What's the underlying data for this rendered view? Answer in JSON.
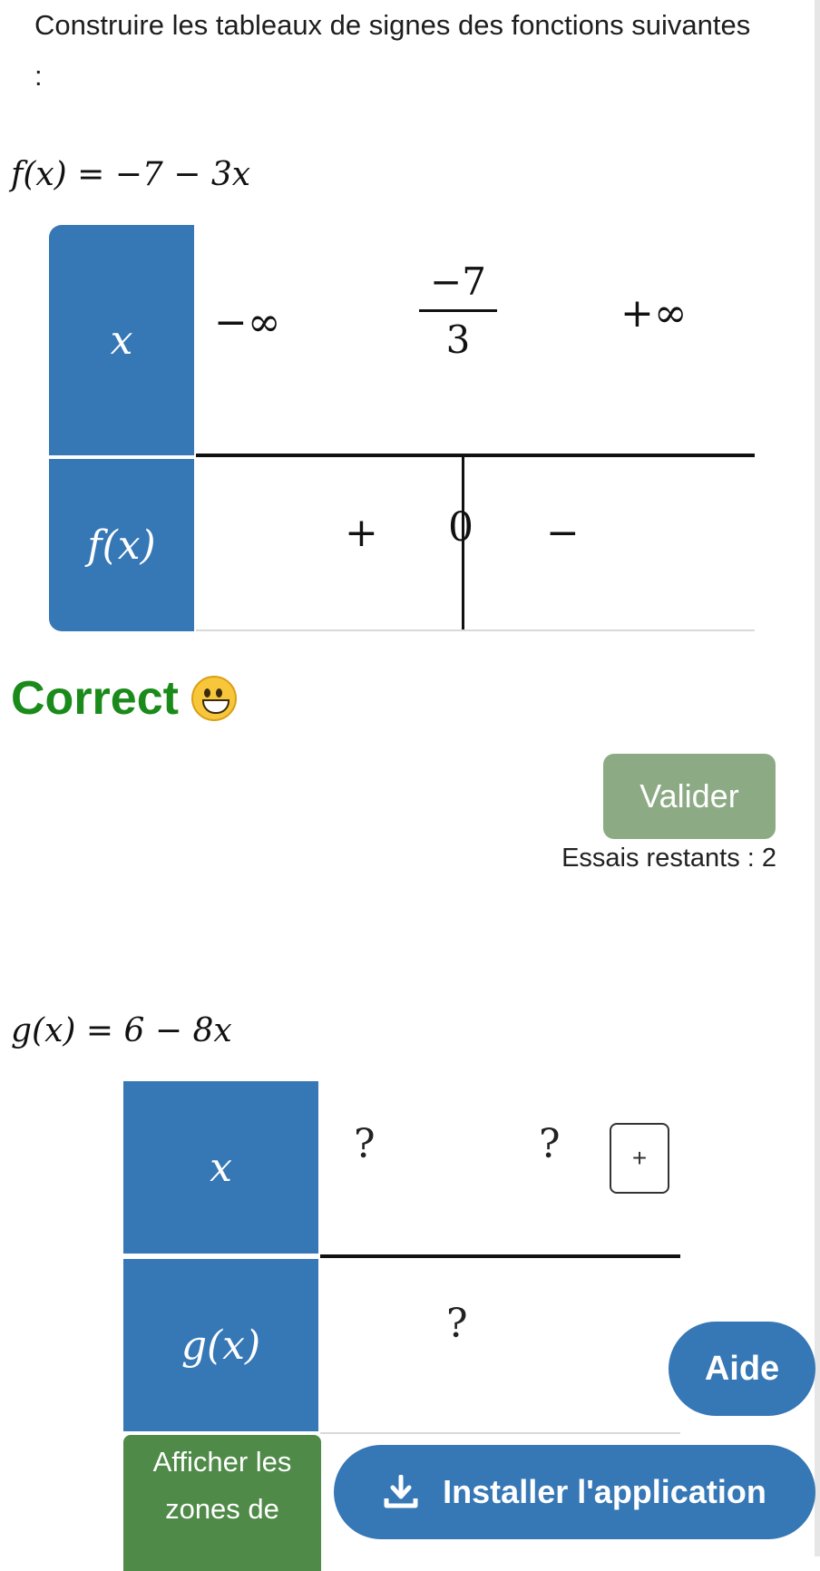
{
  "instructions": "Construire les tableaux de signes des fonctions suivantes :",
  "exercise1": {
    "equation": "f(x) = −7 − 3x",
    "table": {
      "x_label": "x",
      "row_label": "f(x)",
      "x_values": {
        "minus_inf": "−∞",
        "root_num": "−7",
        "root_den": "3",
        "plus_inf": "+∞"
      },
      "signs": {
        "left": "+",
        "zero": "0",
        "right": "−"
      }
    },
    "feedback": "Correct"
  },
  "actions": {
    "valider_label": "Valider",
    "essais_label": "Essais restants : 2"
  },
  "exercise2": {
    "equation": "g(x) = 6 − 8x",
    "table": {
      "x_label": "x",
      "row_label": "g(x)",
      "x_values": [
        "?",
        "?"
      ],
      "sign_value": "?",
      "add_button": "+"
    }
  },
  "floating": {
    "aide_label": "Aide",
    "install_label": "Installer l'application",
    "afficher_label": "Afficher les zones de"
  },
  "colors": {
    "table_head": "#3677b6",
    "valider": "#8cab84",
    "correct": "#1a8a1a",
    "afficher": "#4f8a48"
  },
  "icons": [
    "smiley-icon",
    "download-icon"
  ]
}
